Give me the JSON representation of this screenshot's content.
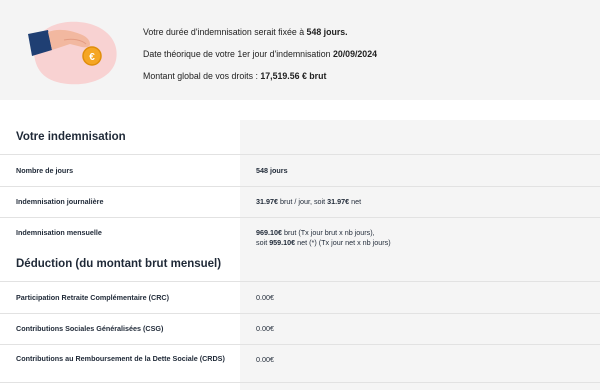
{
  "summary": {
    "illustration_icon": "hand-holding-euro-coin-icon",
    "coin_symbol": "€",
    "duration_text": "Votre durée d'indemnisation serait fixée à ",
    "duration_value": "548 jours.",
    "date_text": "Date théorique de votre 1er jour d'indemnisation ",
    "date_value": "20/09/2024",
    "amount_text": "Montant global de vos droits : ",
    "amount_value": "17,519.56 € brut"
  },
  "indemnisation": {
    "title": "Votre indemnisation",
    "rows": [
      {
        "label": "Nombre de jours",
        "value_bold": "548 jours"
      },
      {
        "label": "Indemnisation journalière",
        "value_bold_1": "31.97€",
        "value_text_1": " brut / jour, soit ",
        "value_bold_2": "31.97€",
        "value_text_2": " net"
      },
      {
        "label": "Indemnisation mensuelle",
        "line1_bold": "969.10€",
        "line1_text": " brut (Tx jour brut x nb jours),",
        "line2_text_a": "soit ",
        "line2_bold": "959.10€",
        "line2_text_b": " net (*) (Tx jour net x nb jours)"
      }
    ]
  },
  "deduction": {
    "title": "Déduction (du montant brut mensuel)",
    "rows": [
      {
        "label": "Participation Retraite Complémentaire (CRC)",
        "value": "0.00€"
      },
      {
        "label": "Contributions Sociales Généralisées (CSG)",
        "value": "0.00€"
      },
      {
        "label": "Contributions au Remboursement de la Dette Sociale (CRDS)",
        "value": "0.00€"
      }
    ]
  },
  "colors": {
    "summary_bg": "#f4f4f4",
    "blob_pink": "#f8d2d2",
    "coin_orange": "#f5a623",
    "sleeve_blue": "#1f3f73",
    "column_shade": "#f5f5f5",
    "divider": "#e2e2e2"
  }
}
